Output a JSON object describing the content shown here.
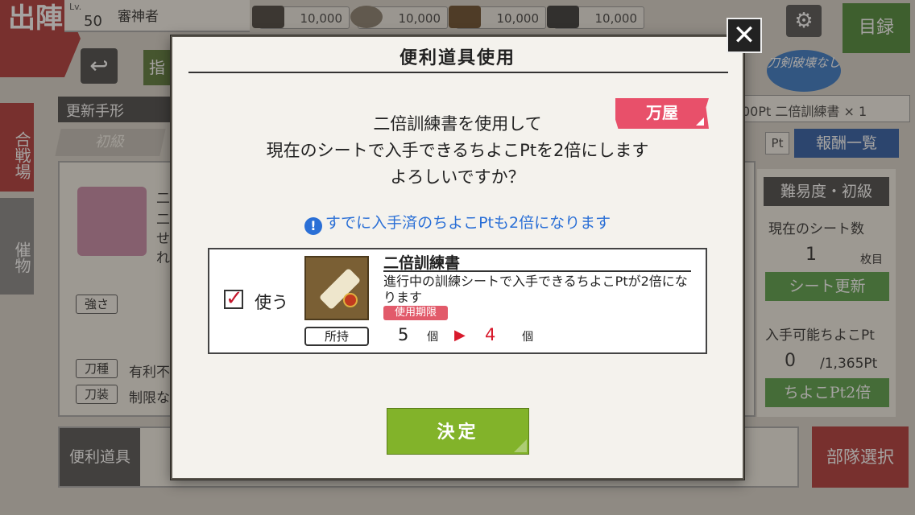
{
  "background": {
    "sortie_label": "出陣",
    "level_prefix": "Lv.",
    "level": "50",
    "player_name": "審神者",
    "resources": [
      "10,000",
      "10,000",
      "10,000",
      "10,000"
    ],
    "catalog_label": "目録",
    "back_icon": "back-arrow-icon",
    "tab_partial": "指",
    "side_tabs": [
      "合戦場",
      "催物"
    ],
    "update_pass_label": "更新手形",
    "difficulty_tab": "初級",
    "broken_badge": "刀剣破壊なし",
    "pt_strip": "00Pt 二倍訓練書 × 1",
    "pt_small": "Pt",
    "reward_list_button": "報酬一覧",
    "difficulty_badge": "難易度・初級",
    "current_sheets_label": "現在のシート数",
    "current_sheets_value": "1",
    "sheets_unit": "枚目",
    "sheet_update_button": "シート更新",
    "obtainable_label": "入手可能ちよこPt",
    "obtainable_value": "0",
    "obtainable_max": "/1,365Pt",
    "double_pt_button": "ちよこPt2倍",
    "stat_tags": [
      "強さ",
      "刀種",
      "刀装"
    ],
    "stat_texts": [
      "有利不",
      "制限な"
    ],
    "partial_texts": [
      "二",
      "二",
      "せ",
      "れ"
    ],
    "tool_label": "便利道具",
    "squad_button": "部隊選択"
  },
  "modal": {
    "title": "便利道具使用",
    "shop_tag": "万屋",
    "message": [
      "二倍訓練書を使用して",
      "現在のシートで入手できるちよこPtを2倍にします",
      "よろしいですか？"
    ],
    "notice_icon": "!",
    "notice": "すでに入手済のちよこPtも2倍になります",
    "item": {
      "checked": true,
      "checkbox_glyph": "✓",
      "use_label": "使う",
      "name": "二倍訓練書",
      "description": "進行中の訓練シートで入手できるちよこPtが2倍になります",
      "expiry_label": "使用期限",
      "owned_label": "所持",
      "count_before": "5",
      "count_after": "4",
      "unit": "個",
      "arrow": "▶"
    },
    "confirm_button": "決定",
    "close_glyph": "✕"
  }
}
